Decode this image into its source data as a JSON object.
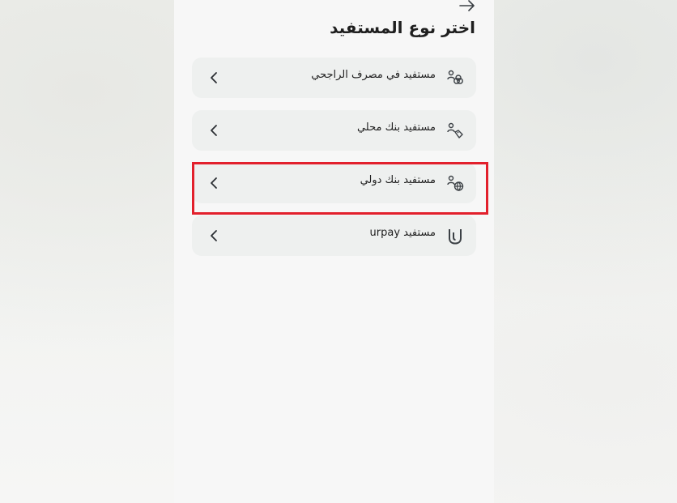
{
  "page": {
    "title": "اختر نوع المستفيد"
  },
  "header": {
    "back_icon": "arrow-right-icon"
  },
  "options": [
    {
      "label": "مستفيد في مصرف الراجحي",
      "icon": "users-link-icon"
    },
    {
      "label": "مستفيد بنك محلي",
      "icon": "user-tag-icon"
    },
    {
      "label": "مستفيد بنك دولي",
      "icon": "user-globe-icon"
    },
    {
      "label": "مستفيد urpay",
      "icon": "urpay-logo-icon"
    }
  ],
  "highlight": {
    "color": "#e2202c",
    "target": "مستفيد بنك دولي"
  },
  "colors": {
    "card_background": "#eef0ef",
    "screen_background": "#f7f7f7",
    "text": "#1f1f1f"
  }
}
